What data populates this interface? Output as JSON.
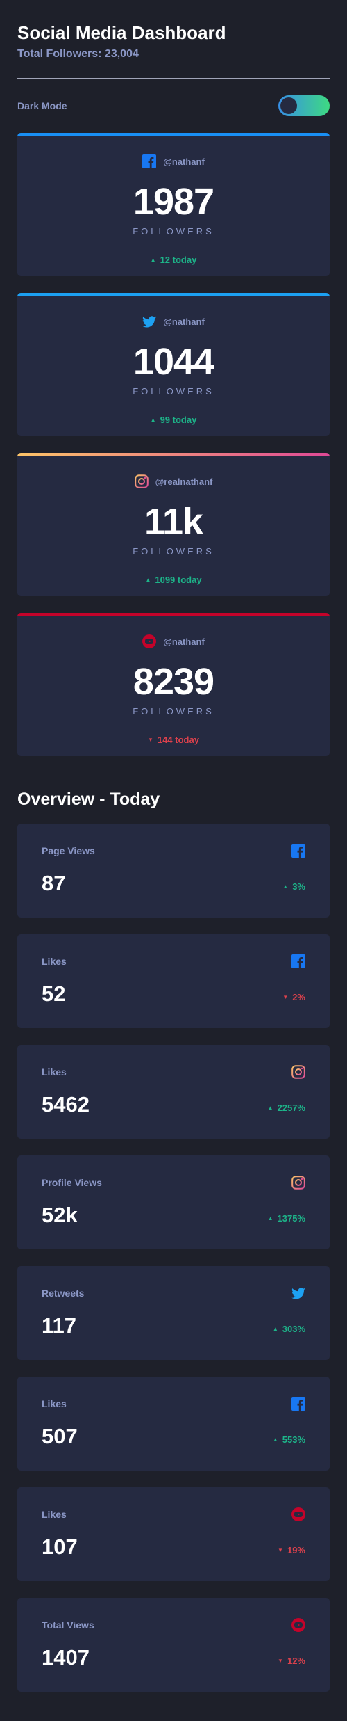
{
  "header": {
    "title": "Social Media Dashboard",
    "total_followers": "Total Followers: 23,004"
  },
  "dark_mode": {
    "label": "Dark Mode",
    "enabled": true
  },
  "colors": {
    "facebook": "#1877f2",
    "twitter": "#1da1f2",
    "instagram_start": "#fdc468",
    "instagram_end": "#df4996",
    "youtube": "#c4032a",
    "up": "#1db489",
    "down": "#dc414c"
  },
  "follower_cards": [
    {
      "network": "facebook",
      "icon": "facebook-icon",
      "handle": "@nathanf",
      "count": "1987",
      "label": "FOLLOWERS",
      "change": "12 today",
      "trend": "up"
    },
    {
      "network": "twitter",
      "icon": "twitter-icon",
      "handle": "@nathanf",
      "count": "1044",
      "label": "FOLLOWERS",
      "change": "99 today",
      "trend": "up"
    },
    {
      "network": "instagram",
      "icon": "instagram-icon",
      "handle": "@realnathanf",
      "count": "11k",
      "label": "FOLLOWERS",
      "change": "1099 today",
      "trend": "up"
    },
    {
      "network": "youtube",
      "icon": "youtube-icon",
      "handle": "@nathanf",
      "count": "8239",
      "label": "FOLLOWERS",
      "change": "144 today",
      "trend": "down"
    }
  ],
  "overview": {
    "title": "Overview - Today",
    "cards": [
      {
        "metric": "Page Views",
        "network": "facebook",
        "icon": "facebook-icon",
        "value": "87",
        "change": "3%",
        "trend": "up"
      },
      {
        "metric": "Likes",
        "network": "facebook",
        "icon": "facebook-icon",
        "value": "52",
        "change": "2%",
        "trend": "down"
      },
      {
        "metric": "Likes",
        "network": "instagram",
        "icon": "instagram-icon",
        "value": "5462",
        "change": "2257%",
        "trend": "up"
      },
      {
        "metric": "Profile Views",
        "network": "instagram",
        "icon": "instagram-icon",
        "value": "52k",
        "change": "1375%",
        "trend": "up"
      },
      {
        "metric": "Retweets",
        "network": "twitter",
        "icon": "twitter-icon",
        "value": "117",
        "change": "303%",
        "trend": "up"
      },
      {
        "metric": "Likes",
        "network": "facebook",
        "icon": "facebook-icon",
        "value": "507",
        "change": "553%",
        "trend": "up"
      },
      {
        "metric": "Likes",
        "network": "youtube",
        "icon": "youtube-icon",
        "value": "107",
        "change": "19%",
        "trend": "down"
      },
      {
        "metric": "Total Views",
        "network": "youtube",
        "icon": "youtube-icon",
        "value": "1407",
        "change": "12%",
        "trend": "down"
      }
    ]
  }
}
